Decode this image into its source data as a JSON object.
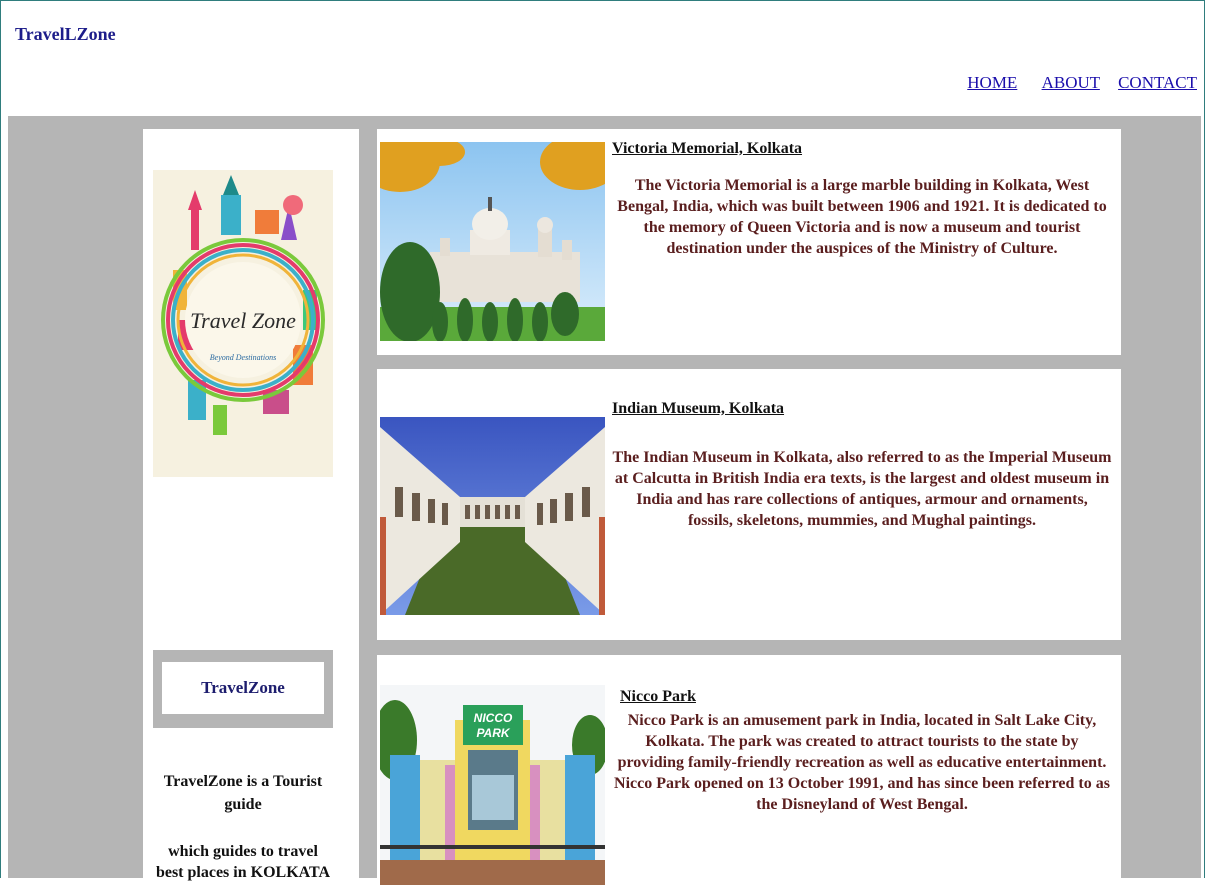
{
  "header": {
    "brand": "TravelLZone",
    "nav": [
      {
        "label": "HOME"
      },
      {
        "label": "ABOUT"
      },
      {
        "label": "CONTACT"
      }
    ]
  },
  "sidebar": {
    "logo_text": "Travel Zone",
    "logo_subtext": "Beyond Destinations",
    "box_title": "TravelZone",
    "description_1": "TravelZone is a Tourist guide",
    "description_2": "which guides to travel best places in KOLKATA"
  },
  "places": [
    {
      "title": "Victoria Memorial, Kolkata",
      "description": "The Victoria Memorial is a large marble building in Kolkata, West Bengal, India, which was built between 1906 and 1921. It is dedicated to the memory of Queen Victoria and is now a museum and tourist destination under the auspices of the Ministry of Culture."
    },
    {
      "title": "Indian Museum, Kolkata",
      "description": "The Indian Museum in Kolkata, also referred to as the Imperial Museum at Calcutta in British India era texts, is the largest and oldest museum in India and has rare collections of antiques, armour and ornaments, fossils, skeletons, mummies, and Mughal paintings."
    },
    {
      "title": "Nicco Park",
      "description": "Nicco Park is an amusement park in India, located in Salt Lake City, Kolkata. The park was created to attract tourists to the state by providing family-friendly recreation as well as educative entertainment. Nicco Park opened on 13 October 1991, and has since been referred to as the Disneyland of West Bengal.",
      "sign_text": "NICCO PARK"
    }
  ],
  "colors": {
    "brand": "#1d1d8a",
    "link": "#1a0dab",
    "background_gray": "#b5b5b5",
    "description_text": "#5a1e1e"
  }
}
